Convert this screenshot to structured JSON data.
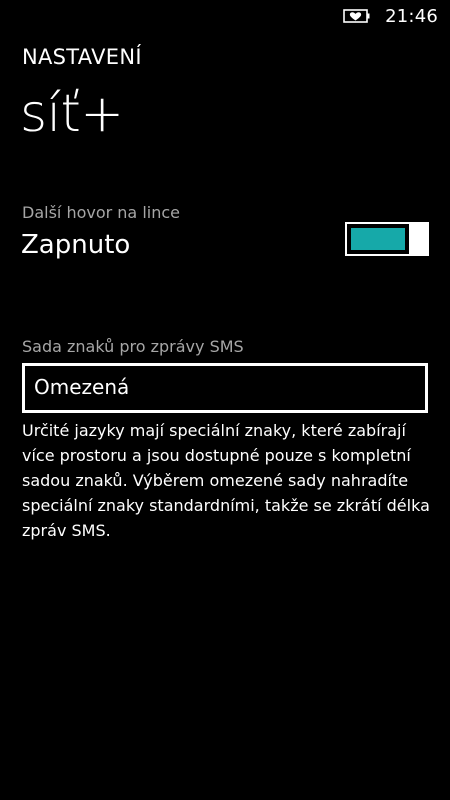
{
  "status_bar": {
    "battery_icon": "battery-heart-icon",
    "time": "21:46"
  },
  "header": {
    "app_title": "NASTAVENÍ",
    "page_title": "síť+"
  },
  "call_waiting": {
    "label": "Další hovor na lince",
    "value": "Zapnuto",
    "toggle_on": true,
    "accent_color": "#16a9a9"
  },
  "sms_charset": {
    "label": "Sada znaků pro zprávy SMS",
    "selected": "Omezená",
    "description": "Určité jazyky mají speciální znaky, které zabírají více prostoru a jsou dostupné pouze s kompletní sadou znaků. Výběrem omezené sady nahradíte speciální znaky standardními, takže se zkrátí délka zpráv SMS."
  }
}
